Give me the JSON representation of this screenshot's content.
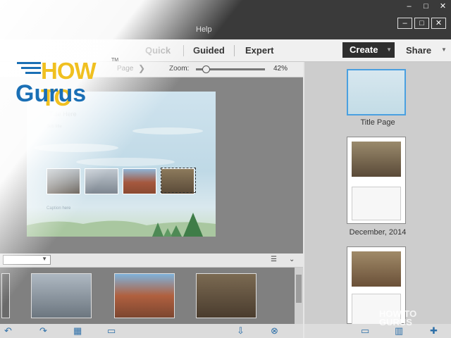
{
  "menu": {
    "help": "Help"
  },
  "window_controls": {
    "minimize": "–",
    "restore": "□",
    "close": "✕"
  },
  "modes": {
    "quick": "Quick",
    "guided": "Guided",
    "expert": "Expert"
  },
  "create": {
    "label": "Create"
  },
  "share": {
    "label": "Share"
  },
  "toolbar": {
    "page_label": "Page",
    "zoom_label": "Zoom:",
    "zoom_value": "42%",
    "zoom_level": 0.1
  },
  "page": {
    "title_placeholder": "Title Here",
    "subtitle_placeholder": "Sub title",
    "caption_placeholder": "Caption here"
  },
  "pages_panel": {
    "items": [
      {
        "caption": "Title Page"
      },
      {
        "caption": "December, 2014"
      },
      {
        "caption": ""
      }
    ]
  },
  "watermark": {
    "logo_line1": "HOW TO",
    "logo_line2": "Gurus",
    "small_line1": "HOW TO",
    "small_line2": "GURUS"
  },
  "colors": {
    "accent_blue": "#1a6fb5",
    "logo_yellow": "#f0c020",
    "create_bg": "#2e2e2e",
    "toolbar_blue": "#2d6fa8"
  }
}
